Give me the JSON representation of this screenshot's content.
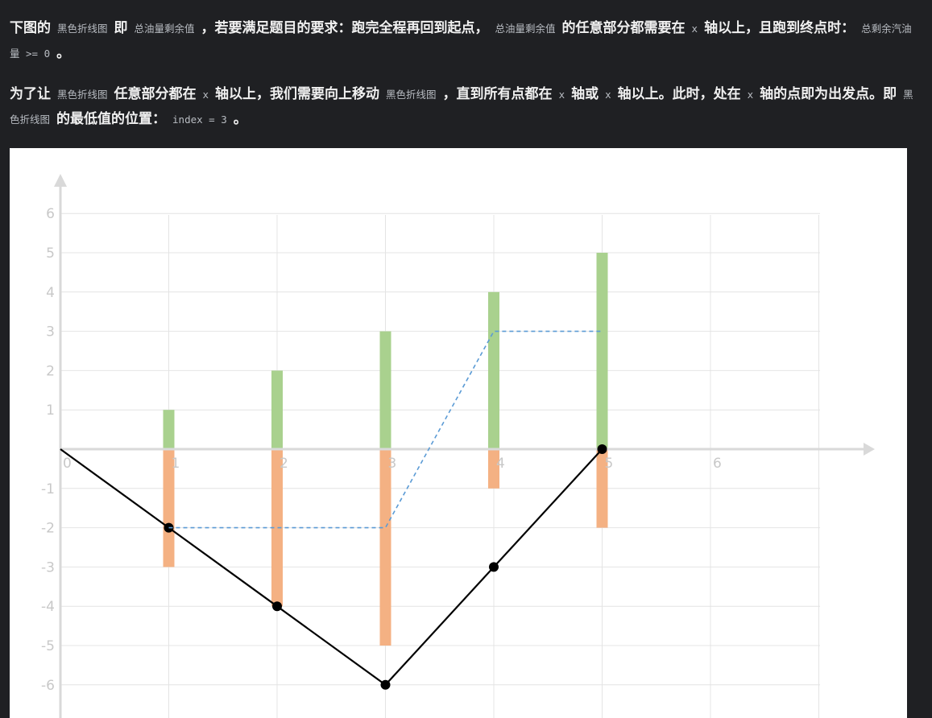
{
  "text": {
    "p1": [
      {
        "t": "下图的"
      },
      {
        "t": "黑色折线图",
        "code": true
      },
      {
        "t": "即"
      },
      {
        "t": "总油量剩余值",
        "code": true
      },
      {
        "t": "，若要满足题目的要求：跑完全程再回到起点，"
      },
      {
        "t": "总油量剩余值",
        "code": true
      },
      {
        "t": "的任意部分都需要在"
      },
      {
        "t": "x",
        "code": true
      },
      {
        "t": "轴以上，且跑到终点时："
      },
      {
        "t": "总剩余汽油量 >= 0",
        "code": true
      },
      {
        "t": "。"
      }
    ],
    "p2": [
      {
        "t": "为了让"
      },
      {
        "t": "黑色折线图",
        "code": true
      },
      {
        "t": "任意部分都在"
      },
      {
        "t": "x",
        "code": true
      },
      {
        "t": "轴以上，我们需要向上移动"
      },
      {
        "t": "黑色折线图",
        "code": true
      },
      {
        "t": "，直到所有点都在"
      },
      {
        "t": "x",
        "code": true
      },
      {
        "t": "轴或"
      },
      {
        "t": "x",
        "code": true
      },
      {
        "t": "轴以上。此时，处在"
      },
      {
        "t": "x",
        "code": true
      },
      {
        "t": "轴的点即为出发点。即"
      },
      {
        "t": "黑色折线图",
        "code": true
      },
      {
        "t": "的最低值的位置："
      },
      {
        "t": "index = 3",
        "code": true
      },
      {
        "t": "。"
      }
    ]
  },
  "chart_data": {
    "type": "bar",
    "x_ticks": [
      "0",
      "1",
      "2",
      "3",
      "4",
      "5",
      "6"
    ],
    "y_ticks": [
      "6",
      "5",
      "4",
      "3",
      "2",
      "1",
      "-1",
      "-2",
      "-3",
      "-4",
      "-5",
      "-6"
    ],
    "xlim": [
      0,
      7
    ],
    "ylim": [
      -6.7,
      6.6
    ],
    "grid": true,
    "series": [
      {
        "kind": "bar",
        "color": "#a9d18e",
        "x": [
          1,
          2,
          3,
          4,
          5
        ],
        "values": [
          1,
          2,
          3,
          4,
          5
        ]
      },
      {
        "kind": "bar",
        "color": "#f4b183",
        "x": [
          1,
          2,
          3,
          4,
          5
        ],
        "values": [
          -3,
          -4,
          -5,
          -1,
          -2
        ]
      },
      {
        "kind": "line",
        "color": "#000000",
        "markers": true,
        "x": [
          0,
          1,
          2,
          3,
          4,
          5
        ],
        "values": [
          0,
          -2,
          -4,
          -6,
          -3,
          0
        ]
      },
      {
        "kind": "line",
        "color": "#5b9bd5",
        "dashed": true,
        "x": [
          1,
          2,
          3,
          4,
          5
        ],
        "values": [
          -2,
          -2,
          -2,
          3,
          3
        ]
      }
    ]
  }
}
